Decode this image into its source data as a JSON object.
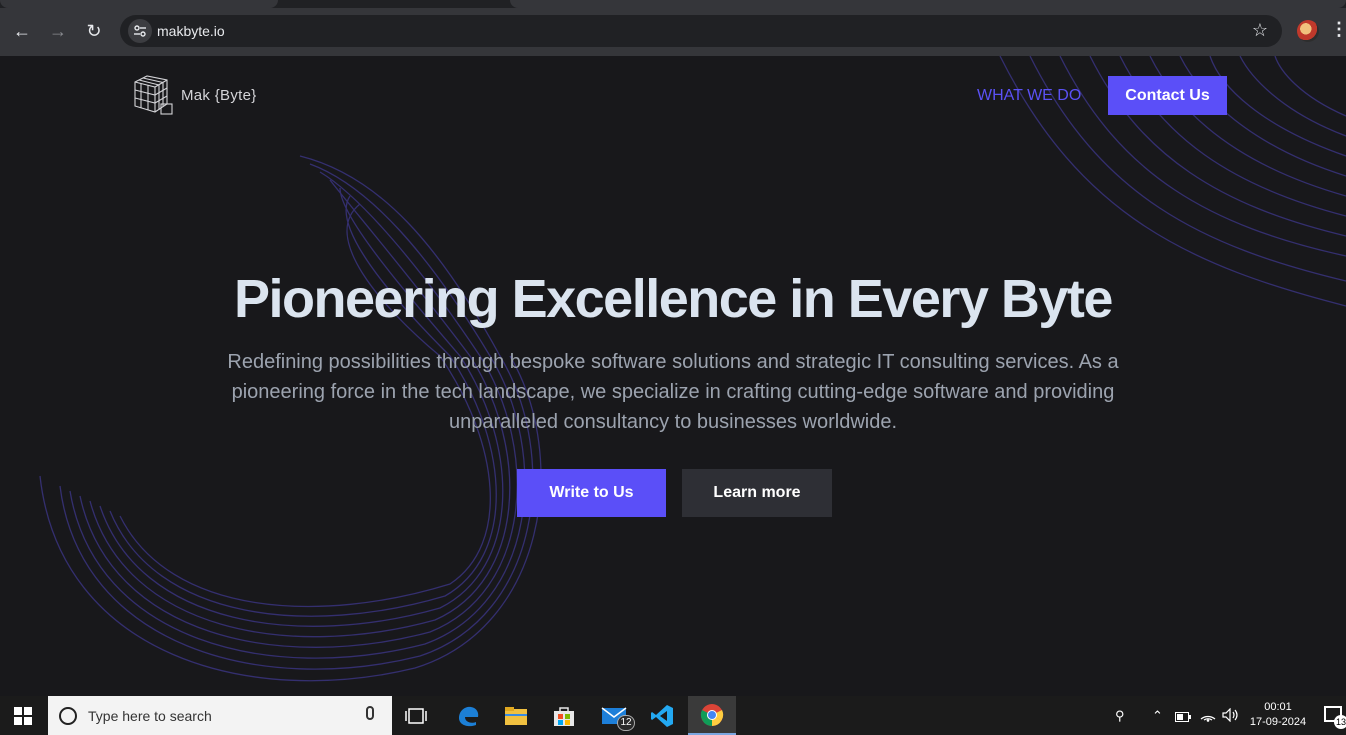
{
  "browser": {
    "url": "makbyte.io",
    "back_icon": "←",
    "forward_icon": "→",
    "reload_icon": "↻",
    "star_icon": "☆",
    "menu_icon": "⋮"
  },
  "site": {
    "logo_text": "Mak {Byte}",
    "nav_link": "WHAT WE DO",
    "contact_button": "Contact Us",
    "headline": "Pioneering Excellence in Every Byte",
    "subtitle": "Redefining possibilities through bespoke software solutions and strategic IT consulting services. As a pioneering force in the tech landscape, we specialize in crafting cutting-edge software and providing unparalleled consultancy to businesses worldwide.",
    "primary_button": "Write to Us",
    "secondary_button": "Learn more",
    "colors": {
      "accent": "#5b4ff8",
      "background": "#18181b",
      "headline": "#dbe4ef",
      "subtitle": "#9ca3af"
    }
  },
  "taskbar": {
    "search_placeholder": "Type here to search",
    "mail_badge": "12",
    "time": "00:01",
    "date": "17-09-2024",
    "notification_count": "13"
  }
}
